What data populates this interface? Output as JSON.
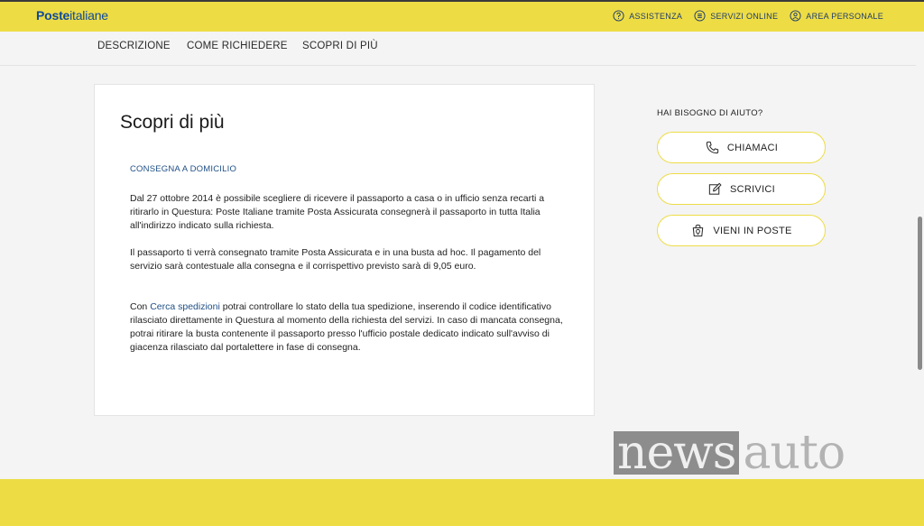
{
  "header": {
    "logo_bold": "Poste",
    "logo_light": "italiane",
    "links": [
      {
        "label": "ASSISTENZA",
        "icon": "question-circle-icon"
      },
      {
        "label": "SERVIZI ONLINE",
        "icon": "list-circle-icon"
      },
      {
        "label": "AREA PERSONALE",
        "icon": "user-circle-icon"
      }
    ]
  },
  "subnav": {
    "items": [
      "DESCRIZIONE",
      "COME RICHIEDERE",
      "SCOPRI DI PIÙ"
    ]
  },
  "content": {
    "title": "Scopri di più",
    "section_label": "CONSEGNA A DOMICILIO",
    "paragraph1": "Dal 27 ottobre 2014 è possibile scegliere di ricevere il passaporto a casa o in ufficio senza recarti a ritirarlo in Questura: Poste Italiane tramite Posta Assicurata consegnerà il passaporto in tutta Italia all'indirizzo indicato sulla richiesta.",
    "paragraph2": "Il passaporto ti verrà consegnato tramite Posta Assicurata e in una busta ad hoc. Il pagamento del servizio sarà contestuale alla consegna e il corrispettivo previsto sarà di 9,05 euro.",
    "paragraph3_prefix": "Con ",
    "paragraph3_link": "Cerca spedizioni",
    "paragraph3_suffix": " potrai controllare lo stato della tua spedizione, inserendo il codice identificativo rilasciato direttamente in Questura al momento della richiesta del servizi. In caso di mancata consegna, potrai ritirare la busta contenente il passaporto presso l'ufficio postale dedicato indicato sull'avviso di giacenza rilasciato dal portalettere in fase di consegna."
  },
  "help": {
    "title": "HAI BISOGNO DI AIUTO?",
    "buttons": [
      {
        "label": "CHIAMACI",
        "icon": "phone-icon"
      },
      {
        "label": "SCRIVICI",
        "icon": "pencil-icon"
      },
      {
        "label": "VIENI IN POSTE",
        "icon": "location-bag-icon"
      }
    ]
  },
  "watermark": {
    "part1": "news",
    "part2": "auto"
  },
  "colors": {
    "brand_yellow": "#eedc45",
    "brand_blue": "#0f4a9a",
    "link_blue": "#1f4f86"
  }
}
